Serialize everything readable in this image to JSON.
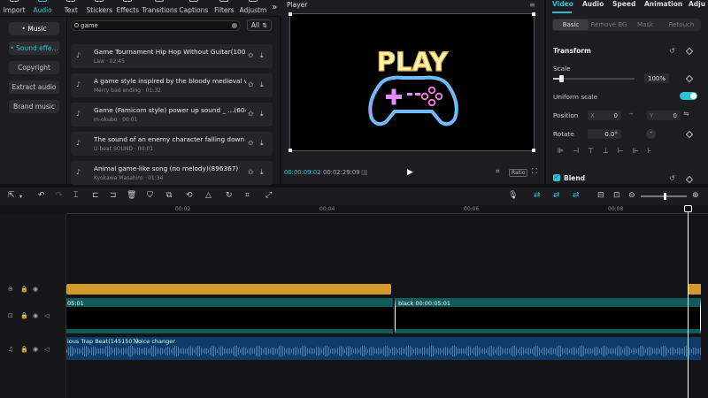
{
  "toolbar": {
    "tabs": [
      {
        "label": "Import"
      },
      {
        "label": "Audio"
      },
      {
        "label": "Text"
      },
      {
        "label": "Stickers"
      },
      {
        "label": "Effects"
      },
      {
        "label": "Transitions"
      },
      {
        "label": "Captions"
      },
      {
        "label": "Filters"
      },
      {
        "label": "Adjustm"
      }
    ],
    "more": "»"
  },
  "categories": [
    {
      "label": "• Music"
    },
    {
      "label": "• Sound effe..."
    },
    {
      "label": "Copyright"
    },
    {
      "label": "Extract audio"
    },
    {
      "label": "Brand music"
    }
  ],
  "search": {
    "value": "game"
  },
  "filter": {
    "label": "All"
  },
  "tracks": [
    {
      "title": "Game Tournament Hip Hop Without Guitar(1003...",
      "sub": "Law · 02:45"
    },
    {
      "title": "A game style inspired by the bloody medieval w...",
      "sub": "Merry bad ending · 01:32"
    },
    {
      "title": "Game (Famicom style) power up sound _ ...(6040)",
      "sub": "m-okubo · 00:01"
    },
    {
      "title": "The sound of an enemy character falling down G...",
      "sub": "U-beat SOUND · 00:01"
    },
    {
      "title": "Animal game-like song (no melody)(896367)",
      "sub": "Kyokawa Masahiro · 01:34"
    }
  ],
  "player": {
    "title": "Player",
    "canvas_text": "PLAY",
    "current_time": "00:00:09:02",
    "total_time": "00:02:29:09",
    "ratio": "Ratio"
  },
  "right": {
    "tabs": [
      "Video",
      "Audio",
      "Speed",
      "Animation",
      "Adju"
    ],
    "subtabs": [
      "Basic",
      "Remove BG",
      "Mask",
      "Retouch"
    ],
    "transform": "Transform",
    "scale_label": "Scale",
    "scale_value": "100%",
    "scale_fraction": 0.1,
    "uniform_scale": "Uniform scale",
    "position_label": "Position",
    "pos_x_label": "X",
    "pos_x": "0",
    "pos_y_label": "Y",
    "pos_y": "0",
    "rotate_label": "Rotate",
    "rotate_value": "0.0°",
    "blend": "Blend"
  },
  "timeline": {
    "ticks": [
      "00:02",
      "00:04",
      "00:06",
      "00:08"
    ],
    "clip1_label": "05:01",
    "clip2_label": "black  00:00:05:01",
    "audio_label": "ious Trap Beat(1451507)",
    "audio_tag": "Voice changer"
  },
  "colors": {
    "accent": "#29c3d6",
    "orange": "#d39a2a",
    "video_clip": "#0f5a5c",
    "audio_clip": "#0f3b6b"
  }
}
